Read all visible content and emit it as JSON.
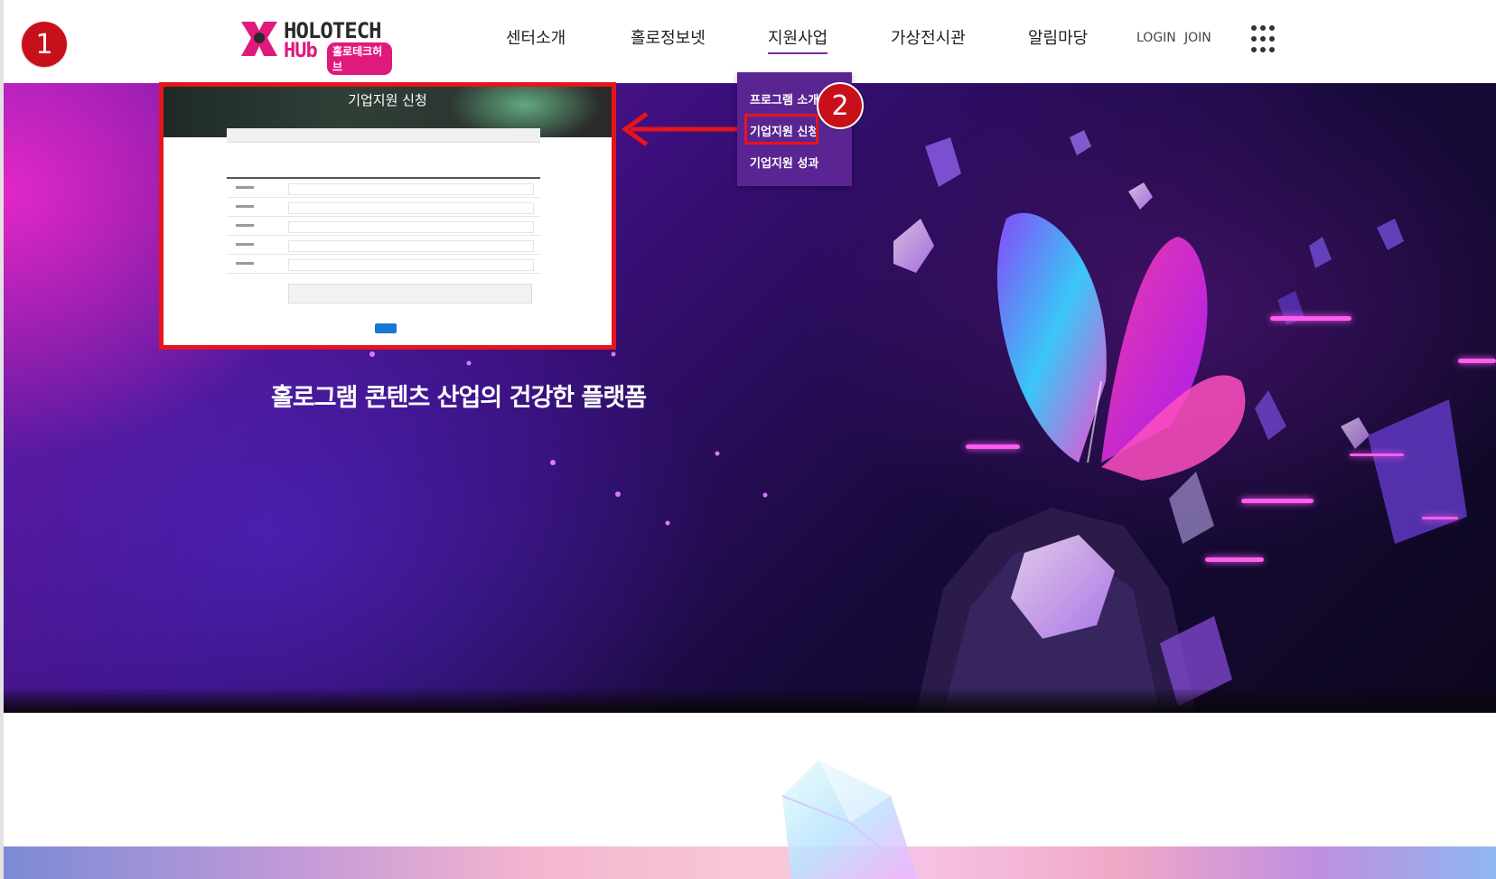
{
  "header": {
    "logo": {
      "word": "HOLOTECH",
      "hub": "HUb",
      "korean": "홀로테크허브"
    },
    "nav": [
      "센터소개",
      "홀로정보넷",
      "지원사업",
      "가상전시관",
      "알림마당"
    ],
    "active_nav_index": 2,
    "auth": {
      "login": "LOGIN",
      "join": "JOIN"
    },
    "menu_icon": "grid-dots-icon"
  },
  "dropdown": {
    "items": [
      "프로그램 소개",
      "기업지원 신청",
      "기업지원 성과"
    ],
    "highlighted_index": 1
  },
  "annotations": {
    "step1": "1",
    "step2": "2",
    "highlight_color": "#e6141c",
    "badge_color": "#c8101b"
  },
  "callout": {
    "title": "기업지원 신청"
  },
  "hero": {
    "tagline": "홀로그램 콘텐츠 산업의 건강한 플랫폼"
  },
  "colors": {
    "accent": "#5a2592",
    "brand_pink": "#e0197d"
  }
}
